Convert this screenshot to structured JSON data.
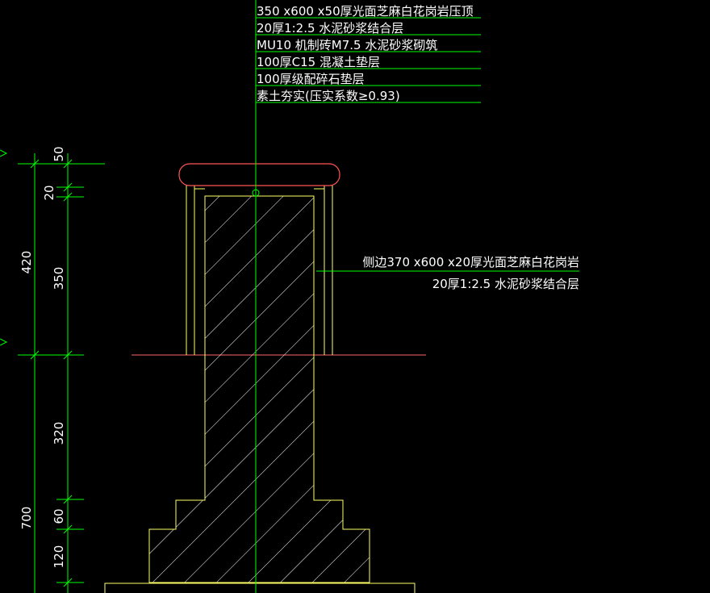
{
  "drawing": {
    "colors": {
      "background": "#000000",
      "leader_line": "#00ff00",
      "outline": "#ffff66",
      "cap_outline": "#ff5555",
      "ground_line": "#ff6666",
      "hatch": "#ffffff",
      "text": "#ffffff",
      "dimension": "#00ff00"
    },
    "layer_notes": [
      "350 x600 x50厚光面芝麻白花岗岩压顶",
      "20厚1:2.5 水泥砂浆结合层",
      "MU10 机制砖M7.5 水泥砂浆砌筑",
      "100厚C15 混凝土垫层",
      "100厚级配碎石垫层",
      "素土夯实(压实系数≥0.93)"
    ],
    "side_notes": [
      "侧边370 x600 x20厚光面芝麻白花岗岩",
      "20厚1:2.5 水泥砂浆结合层"
    ],
    "dimensions": {
      "outer": [
        "420",
        "700"
      ],
      "inner": [
        "50",
        "20",
        "350",
        "320",
        "60",
        "120"
      ]
    }
  }
}
